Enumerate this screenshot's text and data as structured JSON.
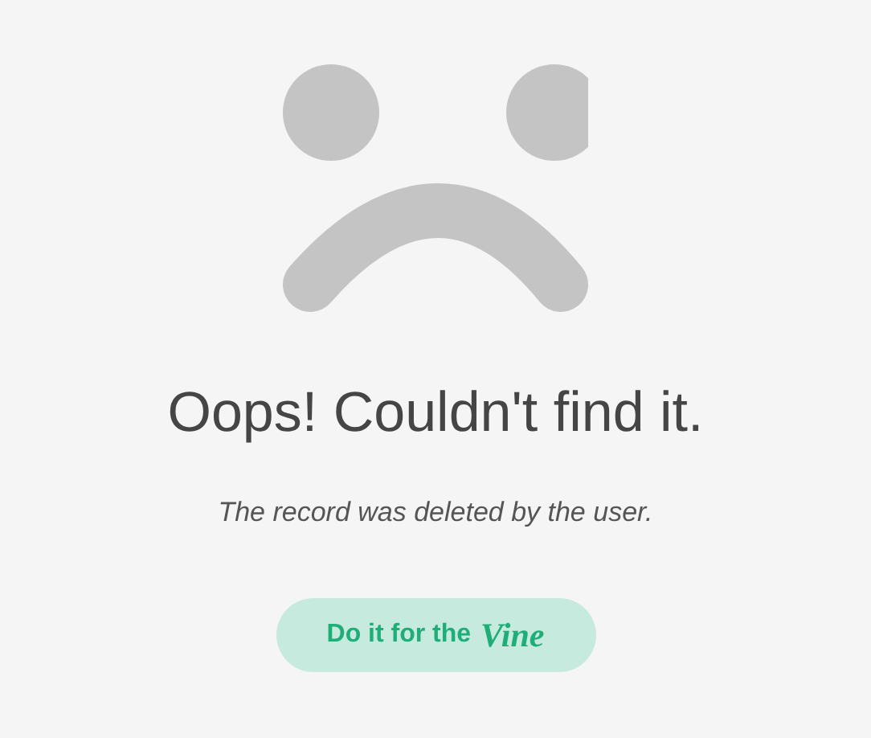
{
  "heading": "Oops! Couldn't find it.",
  "message": "The record was deleted by the user.",
  "button": {
    "label": "Do it for the",
    "brand": "Vine"
  }
}
